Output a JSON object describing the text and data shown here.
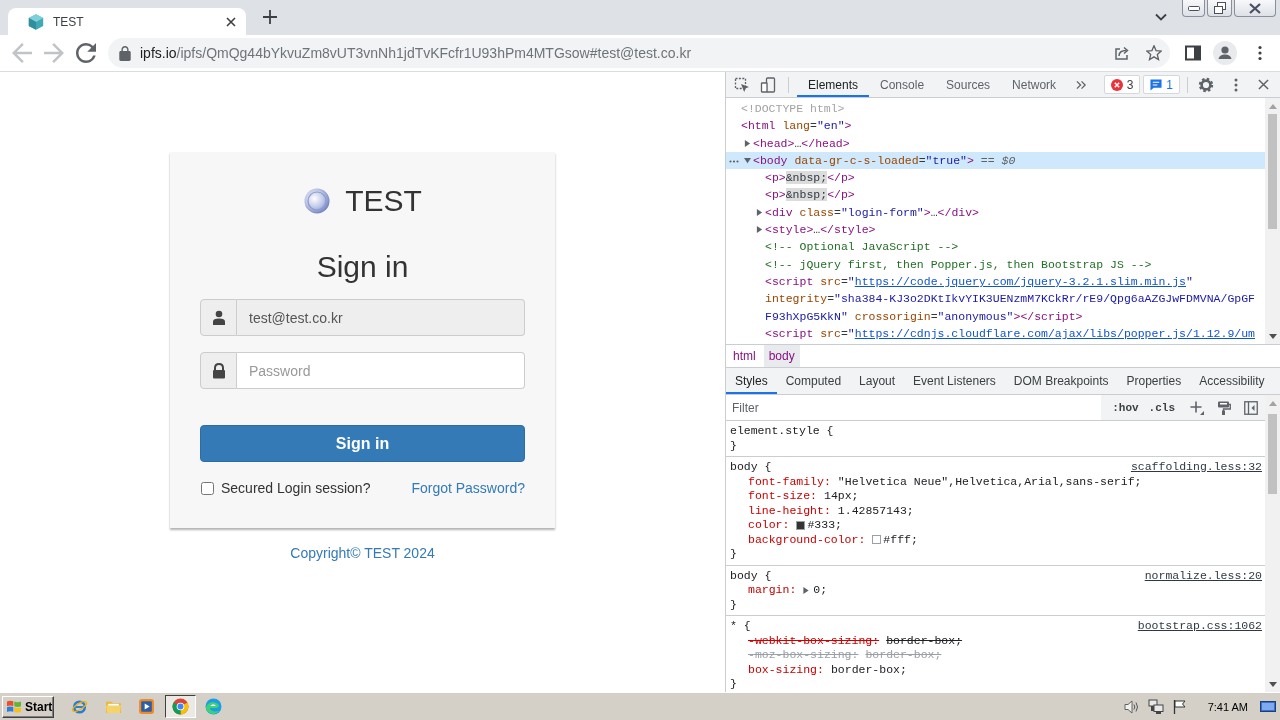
{
  "browser": {
    "tabs": [
      {
        "title": "TEST",
        "selected": true
      }
    ],
    "nav_buttons": [
      {
        "kind": "back",
        "disabled": true
      },
      {
        "kind": "forward",
        "disabled": true
      },
      {
        "kind": "reload",
        "disabled": false
      }
    ],
    "address_bar": {
      "host": "ipfs.io",
      "path": "/ipfs/QmQg44bYkvuZm8vUT3vnNh1jdTvKFcfr1U93hPm4MTGsow#test@test.co.kr"
    }
  },
  "page": {
    "brand": "TEST",
    "heading": "Sign in",
    "email_field": {
      "value": "test@test.co.kr",
      "readonly": true
    },
    "password_field": {
      "placeholder": "Password",
      "readonly": false
    },
    "submit_button": {
      "label": "Sign in"
    },
    "remember_checkbox": {
      "label": "Secured Login session?",
      "checked": false
    },
    "forgot_link": "Forgot Password?",
    "copyright": "Copyright© TEST 2024"
  },
  "devtools": {
    "tabs": [
      {
        "label": "Elements",
        "selected": true
      },
      {
        "label": "Console",
        "selected": false
      },
      {
        "label": "Sources",
        "selected": false
      },
      {
        "label": "Network",
        "selected": false
      }
    ],
    "error_count": "3",
    "message_count": "1",
    "dom_tree": [
      {
        "selected": false,
        "lines": [
          [
            {
              "kind": "doctype",
              "text": "<!DOCTYPE html>"
            }
          ]
        ]
      },
      {
        "selected": false,
        "lines": [
          [
            {
              "kind": "tag",
              "text": "<html"
            },
            {
              "kind": "attr",
              "text": " lang"
            },
            {
              "kind": "punct",
              "text": "="
            },
            {
              "kind": "value",
              "text": "\"en\""
            },
            {
              "kind": "tag",
              "text": ">"
            }
          ]
        ],
        "children": [
          {
            "selected": false,
            "expanded": false,
            "lines": [
              [
                {
                  "kind": "tag",
                  "text": "<head>"
                },
                {
                  "kind": "punct",
                  "text": "…"
                },
                {
                  "kind": "tag",
                  "text": "</head>"
                }
              ]
            ]
          },
          {
            "selected": true,
            "expanded": true,
            "lines": [
              [
                {
                  "kind": "tag",
                  "text": "<body"
                },
                {
                  "kind": "attr",
                  "text": " data-gr-c-s-loaded"
                },
                {
                  "kind": "punct",
                  "text": "="
                },
                {
                  "kind": "value",
                  "text": "\"true\""
                },
                {
                  "kind": "tag",
                  "text": ">"
                },
                {
                  "kind": "hint",
                  "text": " == "
                },
                {
                  "kind": "hint_em",
                  "text": "$0"
                }
              ]
            ],
            "children": [
              {
                "selected": false,
                "lines": [
                  [
                    {
                      "kind": "tag",
                      "text": "<p>"
                    },
                    {
                      "kind": "entity",
                      "text": "&nbsp;"
                    },
                    {
                      "kind": "tag",
                      "text": "</p>"
                    }
                  ]
                ]
              },
              {
                "selected": false,
                "lines": [
                  [
                    {
                      "kind": "tag",
                      "text": "<p>"
                    },
                    {
                      "kind": "entity",
                      "text": "&nbsp;"
                    },
                    {
                      "kind": "tag",
                      "text": "</p>"
                    }
                  ]
                ]
              },
              {
                "selected": false,
                "expanded": false,
                "lines": [
                  [
                    {
                      "kind": "tag",
                      "text": "<div"
                    },
                    {
                      "kind": "attr",
                      "text": " class"
                    },
                    {
                      "kind": "punct",
                      "text": "="
                    },
                    {
                      "kind": "value",
                      "text": "\"login-form\""
                    },
                    {
                      "kind": "tag",
                      "text": ">"
                    },
                    {
                      "kind": "punct",
                      "text": "…"
                    },
                    {
                      "kind": "tag",
                      "text": "</div>"
                    }
                  ]
                ]
              },
              {
                "selected": false,
                "expanded": false,
                "lines": [
                  [
                    {
                      "kind": "tag",
                      "text": "<style>"
                    },
                    {
                      "kind": "punct",
                      "text": "…"
                    },
                    {
                      "kind": "tag",
                      "text": "</style>"
                    }
                  ]
                ]
              },
              {
                "selected": false,
                "lines": [
                  [
                    {
                      "kind": "comment",
                      "text": "<!-- Optional JavaScript -->"
                    }
                  ]
                ]
              },
              {
                "selected": false,
                "lines": [
                  [
                    {
                      "kind": "comment",
                      "text": "<!-- jQuery first, then Popper.js, then Bootstrap JS -->"
                    }
                  ]
                ]
              },
              {
                "selected": false,
                "lines": [
                  [
                    {
                      "kind": "tag",
                      "text": "<script"
                    },
                    {
                      "kind": "attr",
                      "text": " src"
                    },
                    {
                      "kind": "punct",
                      "text": "="
                    },
                    {
                      "kind": "value",
                      "text": "\""
                    },
                    {
                      "kind": "link",
                      "text": "https://code.jquery.com/jquery-3.2.1.slim.min.js"
                    },
                    {
                      "kind": "value",
                      "text": "\""
                    }
                  ],
                  [
                    {
                      "kind": "attr",
                      "text": "integrity"
                    },
                    {
                      "kind": "punct",
                      "text": "="
                    },
                    {
                      "kind": "value",
                      "text": "\"sha384-KJ3o2DKtIkvYIK3UENzmM7KCkRr/rE9/Qpg6aAZGJwFDMVNA/GpGF"
                    }
                  ],
                  [
                    {
                      "kind": "value",
                      "text": "F93hXpG5KkN\""
                    },
                    {
                      "kind": "attr",
                      "text": " crossorigin"
                    },
                    {
                      "kind": "punct",
                      "text": "="
                    },
                    {
                      "kind": "value",
                      "text": "\"anonymous\""
                    },
                    {
                      "kind": "tag",
                      "text": "></script>"
                    }
                  ]
                ]
              },
              {
                "selected": false,
                "lines": [
                  [
                    {
                      "kind": "tag",
                      "text": "<script"
                    },
                    {
                      "kind": "attr",
                      "text": " src"
                    },
                    {
                      "kind": "punct",
                      "text": "="
                    },
                    {
                      "kind": "value",
                      "text": "\""
                    },
                    {
                      "kind": "link",
                      "text": "https://cdnjs.cloudflare.com/ajax/libs/popper.js/1.12.9/um"
                    }
                  ]
                ]
              }
            ]
          }
        ]
      }
    ],
    "breadcrumbs": [
      {
        "label": "html",
        "selected": false
      },
      {
        "label": "body",
        "selected": true
      }
    ],
    "sidebar_tabs": [
      {
        "label": "Styles",
        "selected": true
      },
      {
        "label": "Computed",
        "selected": false
      },
      {
        "label": "Layout",
        "selected": false
      },
      {
        "label": "Event Listeners",
        "selected": false
      },
      {
        "label": "DOM Breakpoints",
        "selected": false
      },
      {
        "label": "Properties",
        "selected": false
      },
      {
        "label": "Accessibility",
        "selected": false
      }
    ],
    "filter": {
      "placeholder": "Filter"
    },
    "filter_buttons": [
      ":hov",
      ".cls"
    ],
    "rules": [
      {
        "selector": "element.style {",
        "close": "}"
      },
      {
        "selector": "body {",
        "source": "scaffolding.less:32",
        "declarations": [
          {
            "property": "font-family:",
            "value": "\"Helvetica Neue\",Helvetica,Arial,sans-serif;",
            "overridden": false,
            "unsupported": false
          },
          {
            "property": "font-size:",
            "value": "14px;",
            "overridden": false,
            "unsupported": false
          },
          {
            "property": "line-height:",
            "value": "1.42857143;",
            "overridden": false,
            "unsupported": false
          },
          {
            "property": "color:",
            "color": "#333333",
            "value": "#333;",
            "overridden": false,
            "unsupported": false
          },
          {
            "property": "background-color:",
            "color": "#ffffff",
            "value": "#fff;",
            "overridden": false,
            "unsupported": false
          }
        ],
        "close": "}"
      },
      {
        "selector": "body {",
        "source": "normalize.less:20",
        "declarations": [
          {
            "property": "margin:",
            "expanded": false,
            "value": "0;",
            "overridden": false,
            "unsupported": false
          }
        ],
        "close": "}"
      },
      {
        "selector": "* {",
        "source": "bootstrap.css:1062",
        "declarations": [
          {
            "property": "-webkit-box-sizing:",
            "value": "border-box;",
            "overridden": true,
            "unsupported": false
          },
          {
            "property": "-moz-box-sizing:",
            "value": "border-box;",
            "overridden": true,
            "unsupported": true
          },
          {
            "property": "box-sizing:",
            "value": "border-box;",
            "overridden": false,
            "unsupported": false
          }
        ],
        "close": "}"
      }
    ]
  },
  "taskbar": {
    "start_label": "Start",
    "apps": [
      {
        "kind": "letter",
        "selected": false
      },
      {
        "kind": "folder",
        "selected": false
      },
      {
        "kind": "player",
        "selected": false
      },
      {
        "kind": "tricolor",
        "selected": true
      },
      {
        "kind": "swirl",
        "selected": false
      }
    ],
    "clock": "7:41 AM"
  }
}
